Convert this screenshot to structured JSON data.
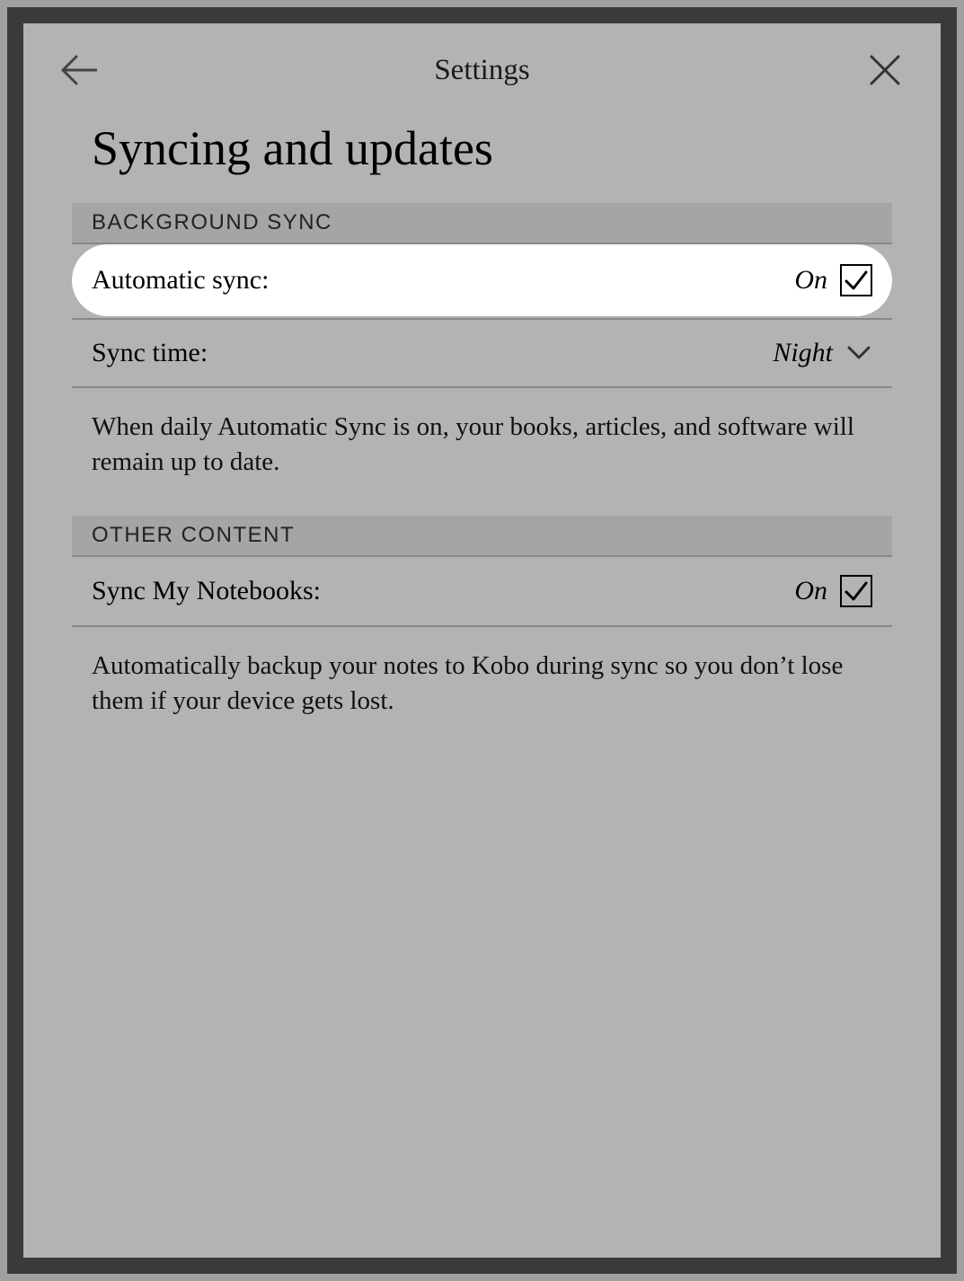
{
  "header": {
    "title": "Settings"
  },
  "page": {
    "title": "Syncing and updates"
  },
  "sections": {
    "background_sync": {
      "header": "BACKGROUND SYNC",
      "automatic_sync": {
        "label": "Automatic sync:",
        "value": "On"
      },
      "sync_time": {
        "label": "Sync time:",
        "value": "Night"
      },
      "description": "When daily Automatic Sync is on, your books, articles, and software will remain up to date."
    },
    "other_content": {
      "header": "OTHER CONTENT",
      "sync_notebooks": {
        "label": "Sync My Notebooks:",
        "value": "On"
      },
      "description": "Automatically backup your notes to Kobo during sync so you don’t lose them if your device gets lost."
    }
  }
}
